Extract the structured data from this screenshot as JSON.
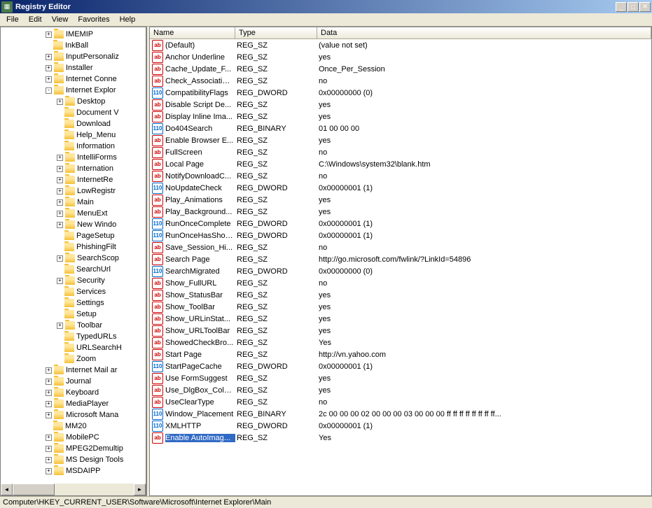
{
  "window": {
    "title": "Registry Editor"
  },
  "menu": {
    "file": "File",
    "edit": "Edit",
    "view": "View",
    "favorites": "Favorites",
    "help": "Help"
  },
  "columns": {
    "name": "Name",
    "type": "Type",
    "data": "Data"
  },
  "tree": [
    {
      "label": "IMEMIP",
      "indent": 4,
      "expand": "+"
    },
    {
      "label": "InkBall",
      "indent": 4,
      "expand": ""
    },
    {
      "label": "InputPersonaliz",
      "indent": 4,
      "expand": "+"
    },
    {
      "label": "Installer",
      "indent": 4,
      "expand": "+"
    },
    {
      "label": "Internet Conne",
      "indent": 4,
      "expand": "+"
    },
    {
      "label": "Internet Explor",
      "indent": 4,
      "expand": "-"
    },
    {
      "label": "Desktop",
      "indent": 5,
      "expand": "+"
    },
    {
      "label": "Document V",
      "indent": 5,
      "expand": ""
    },
    {
      "label": "Download",
      "indent": 5,
      "expand": ""
    },
    {
      "label": "Help_Menu",
      "indent": 5,
      "expand": ""
    },
    {
      "label": "Information",
      "indent": 5,
      "expand": ""
    },
    {
      "label": "IntelliForms",
      "indent": 5,
      "expand": "+"
    },
    {
      "label": "Internation",
      "indent": 5,
      "expand": "+"
    },
    {
      "label": "InternetRe",
      "indent": 5,
      "expand": "+"
    },
    {
      "label": "LowRegistr",
      "indent": 5,
      "expand": "+"
    },
    {
      "label": "Main",
      "indent": 5,
      "expand": "+"
    },
    {
      "label": "MenuExt",
      "indent": 5,
      "expand": "+"
    },
    {
      "label": "New Windo",
      "indent": 5,
      "expand": "+"
    },
    {
      "label": "PageSetup",
      "indent": 5,
      "expand": ""
    },
    {
      "label": "PhishingFilt",
      "indent": 5,
      "expand": ""
    },
    {
      "label": "SearchScop",
      "indent": 5,
      "expand": "+"
    },
    {
      "label": "SearchUrl",
      "indent": 5,
      "expand": ""
    },
    {
      "label": "Security",
      "indent": 5,
      "expand": "+"
    },
    {
      "label": "Services",
      "indent": 5,
      "expand": ""
    },
    {
      "label": "Settings",
      "indent": 5,
      "expand": ""
    },
    {
      "label": "Setup",
      "indent": 5,
      "expand": ""
    },
    {
      "label": "Toolbar",
      "indent": 5,
      "expand": "+"
    },
    {
      "label": "TypedURLs",
      "indent": 5,
      "expand": ""
    },
    {
      "label": "URLSearchH",
      "indent": 5,
      "expand": ""
    },
    {
      "label": "Zoom",
      "indent": 5,
      "expand": ""
    },
    {
      "label": "Internet Mail ar",
      "indent": 4,
      "expand": "+"
    },
    {
      "label": "Journal",
      "indent": 4,
      "expand": "+"
    },
    {
      "label": "Keyboard",
      "indent": 4,
      "expand": "+"
    },
    {
      "label": "MediaPlayer",
      "indent": 4,
      "expand": "+"
    },
    {
      "label": "Microsoft Mana",
      "indent": 4,
      "expand": "+"
    },
    {
      "label": "MM20",
      "indent": 4,
      "expand": ""
    },
    {
      "label": "MobilePC",
      "indent": 4,
      "expand": "+"
    },
    {
      "label": "MPEG2Demultip",
      "indent": 4,
      "expand": "+"
    },
    {
      "label": "MS Design Tools",
      "indent": 4,
      "expand": "+"
    },
    {
      "label": "MSDAIPP",
      "indent": 4,
      "expand": "+"
    }
  ],
  "values": [
    {
      "icon": "sz",
      "name": "(Default)",
      "type": "REG_SZ",
      "data": "(value not set)"
    },
    {
      "icon": "sz",
      "name": "Anchor Underline",
      "type": "REG_SZ",
      "data": "yes"
    },
    {
      "icon": "sz",
      "name": "Cache_Update_F...",
      "type": "REG_SZ",
      "data": "Once_Per_Session"
    },
    {
      "icon": "sz",
      "name": "Check_Associations",
      "type": "REG_SZ",
      "data": "no"
    },
    {
      "icon": "bin",
      "name": "CompatibilityFlags",
      "type": "REG_DWORD",
      "data": "0x00000000 (0)"
    },
    {
      "icon": "sz",
      "name": "Disable Script De...",
      "type": "REG_SZ",
      "data": "yes"
    },
    {
      "icon": "sz",
      "name": "Display Inline Ima...",
      "type": "REG_SZ",
      "data": "yes"
    },
    {
      "icon": "bin",
      "name": "Do404Search",
      "type": "REG_BINARY",
      "data": "01 00 00 00"
    },
    {
      "icon": "sz",
      "name": "Enable Browser E...",
      "type": "REG_SZ",
      "data": "yes"
    },
    {
      "icon": "sz",
      "name": "FullScreen",
      "type": "REG_SZ",
      "data": "no"
    },
    {
      "icon": "sz",
      "name": "Local Page",
      "type": "REG_SZ",
      "data": "C:\\Windows\\system32\\blank.htm"
    },
    {
      "icon": "sz",
      "name": "NotifyDownloadC...",
      "type": "REG_SZ",
      "data": "no"
    },
    {
      "icon": "bin",
      "name": "NoUpdateCheck",
      "type": "REG_DWORD",
      "data": "0x00000001 (1)"
    },
    {
      "icon": "sz",
      "name": "Play_Animations",
      "type": "REG_SZ",
      "data": "yes"
    },
    {
      "icon": "sz",
      "name": "Play_Background...",
      "type": "REG_SZ",
      "data": "yes"
    },
    {
      "icon": "bin",
      "name": "RunOnceComplete",
      "type": "REG_DWORD",
      "data": "0x00000001 (1)"
    },
    {
      "icon": "bin",
      "name": "RunOnceHasShown",
      "type": "REG_DWORD",
      "data": "0x00000001 (1)"
    },
    {
      "icon": "sz",
      "name": "Save_Session_Hi...",
      "type": "REG_SZ",
      "data": "no"
    },
    {
      "icon": "sz",
      "name": "Search Page",
      "type": "REG_SZ",
      "data": "http://go.microsoft.com/fwlink/?LinkId=54896"
    },
    {
      "icon": "bin",
      "name": "SearchMigrated",
      "type": "REG_DWORD",
      "data": "0x00000000 (0)"
    },
    {
      "icon": "sz",
      "name": "Show_FullURL",
      "type": "REG_SZ",
      "data": "no"
    },
    {
      "icon": "sz",
      "name": "Show_StatusBar",
      "type": "REG_SZ",
      "data": "yes"
    },
    {
      "icon": "sz",
      "name": "Show_ToolBar",
      "type": "REG_SZ",
      "data": "yes"
    },
    {
      "icon": "sz",
      "name": "Show_URLinStat...",
      "type": "REG_SZ",
      "data": "yes"
    },
    {
      "icon": "sz",
      "name": "Show_URLToolBar",
      "type": "REG_SZ",
      "data": "yes"
    },
    {
      "icon": "sz",
      "name": "ShowedCheckBro...",
      "type": "REG_SZ",
      "data": "Yes"
    },
    {
      "icon": "sz",
      "name": "Start Page",
      "type": "REG_SZ",
      "data": "http://vn.yahoo.com"
    },
    {
      "icon": "bin",
      "name": "StartPageCache",
      "type": "REG_DWORD",
      "data": "0x00000001 (1)"
    },
    {
      "icon": "sz",
      "name": "Use FormSuggest",
      "type": "REG_SZ",
      "data": "yes"
    },
    {
      "icon": "sz",
      "name": "Use_DlgBox_Colors",
      "type": "REG_SZ",
      "data": "yes"
    },
    {
      "icon": "sz",
      "name": "UseClearType",
      "type": "REG_SZ",
      "data": "no"
    },
    {
      "icon": "bin",
      "name": "Window_Placement",
      "type": "REG_BINARY",
      "data": "2c 00 00 00 02 00 00 00 03 00 00 00 ff ff ff ff ff ff ff ff..."
    },
    {
      "icon": "bin",
      "name": "XMLHTTP",
      "type": "REG_DWORD",
      "data": "0x00000001 (1)"
    },
    {
      "icon": "sz",
      "name": "Enable AutoImag...",
      "type": "REG_SZ",
      "data": "Yes",
      "selected": true
    }
  ],
  "statusbar": "Computer\\HKEY_CURRENT_USER\\Software\\Microsoft\\Internet Explorer\\Main",
  "iconText": {
    "sz": "ab",
    "bin": "110"
  }
}
